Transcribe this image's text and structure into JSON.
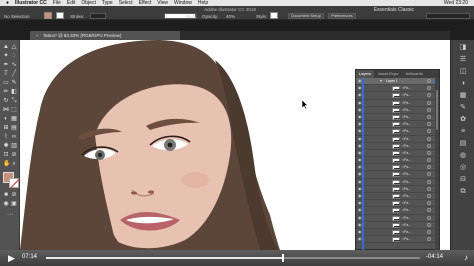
{
  "menubar": {
    "app_name": "Illustrator CC",
    "items": [
      "File",
      "Edit",
      "Object",
      "Type",
      "Select",
      "Effect",
      "View",
      "Window",
      "Help"
    ],
    "clock": "Wed 23:20"
  },
  "controlbar": {
    "window_title": "Adobe Illustrator CC 2019",
    "selection_label": "No Selection",
    "stroke_label": "Stroke:",
    "brush_label": "Basic",
    "opacity_label": "Opacity:",
    "opacity_value": "40%",
    "style_label": "Style:",
    "document_setup": "Document Setup",
    "preferences": "Preferences",
    "workspace": "Essentials Classic"
  },
  "document_tab": {
    "close": "×",
    "title": "Tattoo* @ 83.33% (RGB/GPU Preview)"
  },
  "colors": {
    "fill_swatch": "#c88f7c",
    "hair": "#5c4639",
    "skin": "#e8c2b0",
    "lips": "#b8636a",
    "selection_blue": "#2f6fe0"
  },
  "layers_panel": {
    "tabs": [
      "Layers",
      "Asset Expo",
      "Artboards"
    ],
    "layer_name": "Layer 1",
    "item_name": "<Pa...",
    "items": [
      "<Pa...",
      "<Pa...",
      "<Pa...",
      "<Pa...",
      "<Pa...",
      "<Pa...",
      "<Pa...",
      "<Pa...",
      "<Pa...",
      "<Pa...",
      "<Pa...",
      "<Pa...",
      "<Pa...",
      "<Pa...",
      "<Pa...",
      "<Pa...",
      "<Pa...",
      "<Pa...",
      "<Pa...",
      "<Pa...",
      "<Pa...",
      "<Pa..."
    ]
  },
  "player": {
    "elapsed": "07:14",
    "remaining": "-04:14",
    "progress": 0.63
  }
}
